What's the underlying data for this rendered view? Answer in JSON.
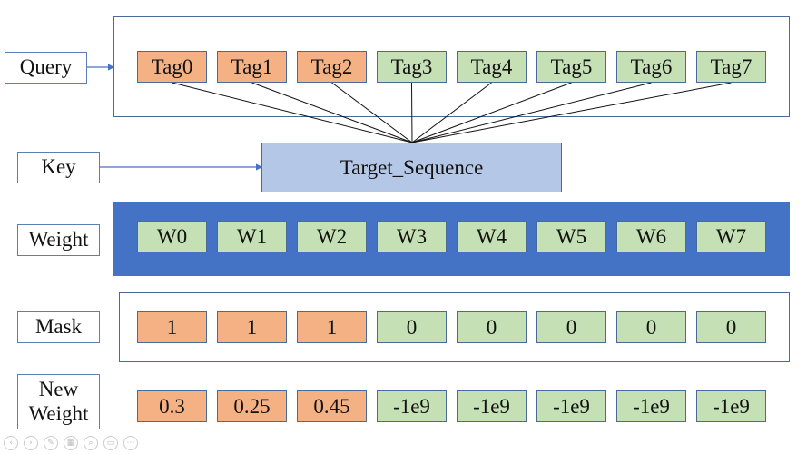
{
  "labels": {
    "query": "Query",
    "key": "Key",
    "weight": "Weight",
    "mask": "Mask",
    "new_weight_line1": "New",
    "new_weight_line2": "Weight"
  },
  "target": "Target_Sequence",
  "tags": [
    {
      "text": "Tag0",
      "color": "orange"
    },
    {
      "text": "Tag1",
      "color": "orange"
    },
    {
      "text": "Tag2",
      "color": "orange"
    },
    {
      "text": "Tag3",
      "color": "green"
    },
    {
      "text": "Tag4",
      "color": "green"
    },
    {
      "text": "Tag5",
      "color": "green"
    },
    {
      "text": "Tag6",
      "color": "green"
    },
    {
      "text": "Tag7",
      "color": "green"
    }
  ],
  "weights": [
    "W0",
    "W1",
    "W2",
    "W3",
    "W4",
    "W5",
    "W6",
    "W7"
  ],
  "mask": [
    "1",
    "1",
    "1",
    "0",
    "0",
    "0",
    "0",
    "0"
  ],
  "new_weights": [
    "0.3",
    "0.25",
    "0.45",
    "-1e9",
    "-1e9",
    "-1e9",
    "-1e9",
    "-1e9"
  ],
  "colors": {
    "orange": "#f4b183",
    "green": "#c5e0b4",
    "target": "#b4c7e7",
    "weight_band": "#4472c4",
    "border": "#4a6a9a"
  },
  "controls": [
    "prev-icon",
    "next-icon",
    "pen-icon",
    "slides-icon",
    "zoom-icon",
    "subtitles-icon",
    "more-icon"
  ]
}
